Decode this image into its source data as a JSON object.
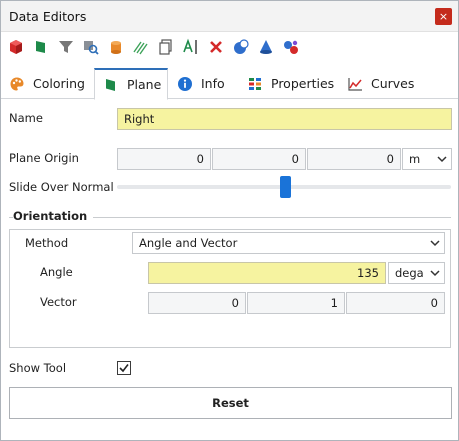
{
  "window": {
    "title": "Data Editors",
    "close_glyph": "×"
  },
  "toolbar": {
    "icons": [
      "red-cube-icon",
      "green-plane-icon",
      "filter-icon",
      "search-data-icon",
      "cylinder-icon",
      "lines-icon",
      "copy-icon",
      "text-cursor-icon",
      "delete-icon",
      "probe-icon",
      "cone-icon",
      "molecule-icon"
    ]
  },
  "tabs": [
    {
      "label": "Coloring",
      "icon": "palette-icon"
    },
    {
      "label": "Plane",
      "icon": "plane-icon",
      "active": true
    },
    {
      "label": "Info",
      "icon": "info-icon"
    },
    {
      "label": "Properties",
      "icon": "properties-icon"
    },
    {
      "label": "Curves",
      "icon": "curves-icon"
    }
  ],
  "form": {
    "name_label": "Name",
    "name_value": "Right",
    "plane_origin_label": "Plane Origin",
    "origin_x": "0",
    "origin_y": "0",
    "origin_z": "0",
    "origin_unit": "m",
    "slide_label": "Slide Over Normal",
    "slide_fraction": 0.505,
    "orientation_title": "Orientation",
    "method_label": "Method",
    "method_value": "Angle and Vector",
    "angle_label": "Angle",
    "angle_value": "135",
    "angle_unit": "dega",
    "vector_label": "Vector",
    "vector_x": "0",
    "vector_y": "1",
    "vector_z": "0",
    "show_tool_label": "Show Tool",
    "show_tool_checked": true,
    "reset_label": "Reset"
  },
  "colors": {
    "accent": "#2e6fb8",
    "slider": "#1a73d8",
    "highlight_field": "#f6f3a0",
    "close": "#c42b1c"
  }
}
